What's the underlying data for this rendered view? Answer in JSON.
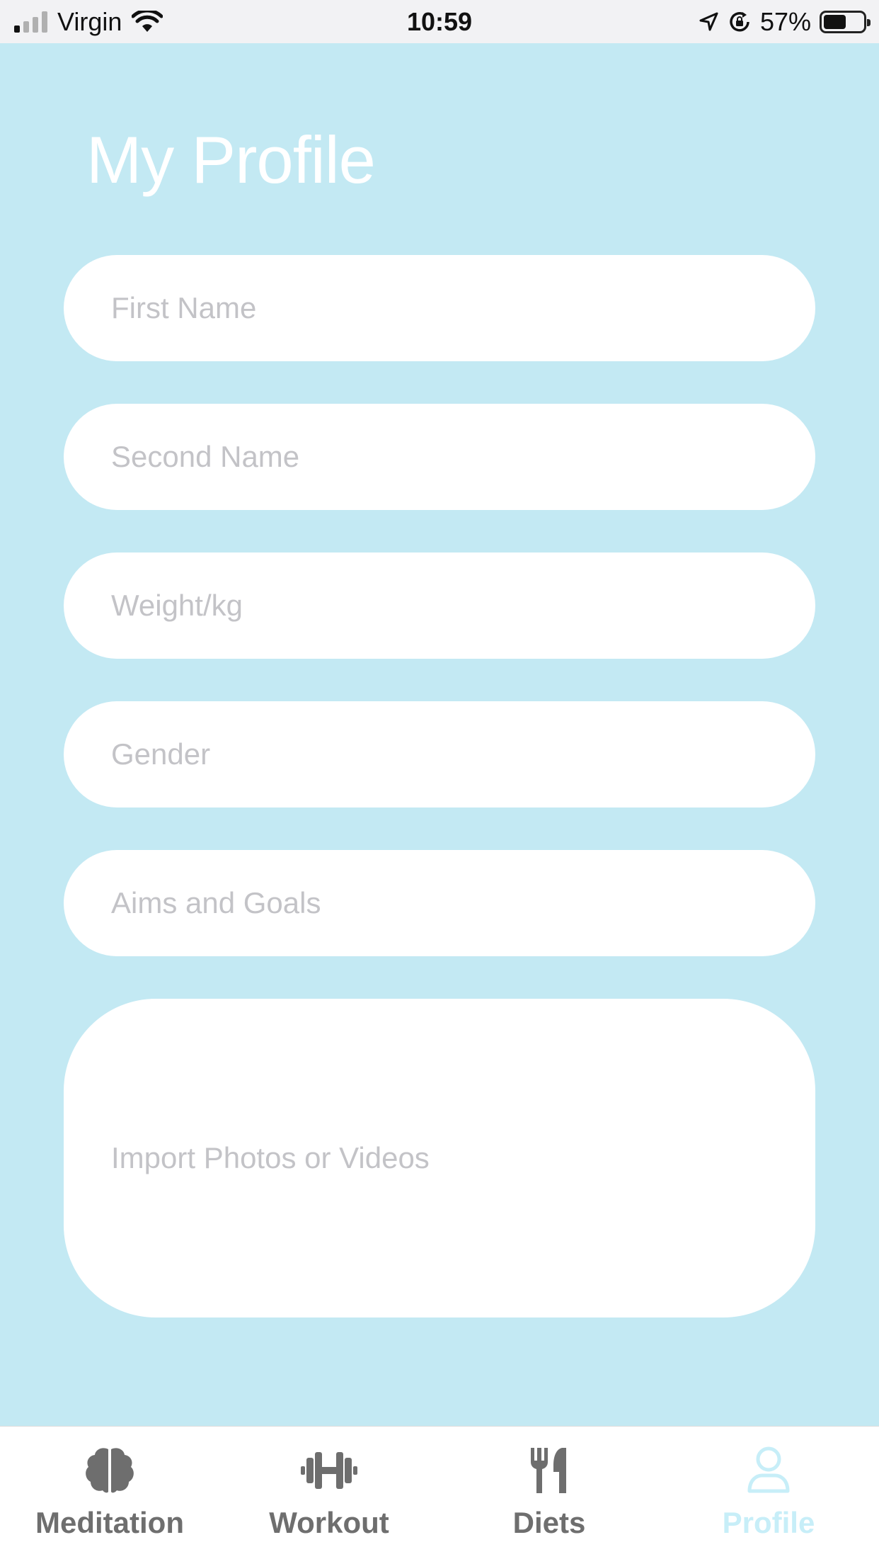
{
  "status_bar": {
    "carrier": "Virgin",
    "time": "10:59",
    "battery_percent": "57%",
    "battery_level": 0.57
  },
  "page": {
    "title": "My Profile"
  },
  "form": {
    "first_name_placeholder": "First Name",
    "second_name_placeholder": "Second Name",
    "weight_placeholder": "Weight/kg",
    "gender_placeholder": "Gender",
    "aims_placeholder": "Aims and Goals",
    "import_media_label": "Import Photos or Videos"
  },
  "tab_bar": {
    "items": [
      {
        "label": "Meditation",
        "icon": "brain-icon"
      },
      {
        "label": "Workout",
        "icon": "dumbbell-icon"
      },
      {
        "label": "Diets",
        "icon": "utensils-icon"
      },
      {
        "label": "Profile",
        "icon": "user-icon"
      }
    ],
    "active": "Profile"
  },
  "colors": {
    "background": "#c3e9f3",
    "field": "#ffffff",
    "placeholder": "#c3c3c7",
    "tab_inactive": "#6e6e6e",
    "tab_active": "#c7eef8"
  }
}
